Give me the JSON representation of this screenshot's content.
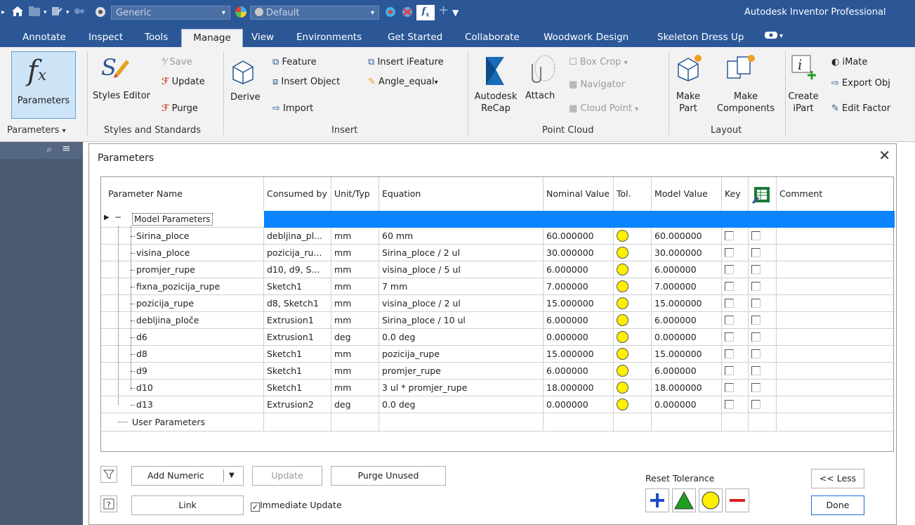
{
  "qat": {
    "style_combo": "Generic",
    "appearance_combo": "Default",
    "app_title": "Autodesk Inventor Professional"
  },
  "menu": {
    "tabs": [
      "Annotate",
      "Inspect",
      "Tools",
      "Manage",
      "View",
      "Environments",
      "Get Started",
      "Collaborate",
      "Woodwork Design",
      "Skeleton Dress Up"
    ],
    "active": "Manage"
  },
  "ribbon": {
    "parameters_label": "Parameters",
    "styles_editor": "Styles Editor",
    "save": "Save",
    "update": "Update",
    "purge": "Purge",
    "derive": "Derive",
    "feature": "Feature",
    "insert_object": "Insert Object",
    "import": "Import",
    "insert_ifeature": "Insert iFeature",
    "angle_equal": "Angle_equal",
    "autodesk_recap_1": "Autodesk",
    "autodesk_recap_2": "ReCap",
    "attach": "Attach",
    "box_crop": "Box Crop",
    "navigator": "Navigator",
    "cloud_point": "Cloud Point",
    "make_part_1": "Make",
    "make_part_2": "Part",
    "make_components_1": "Make",
    "make_components_2": "Components",
    "create_ipart_1": "Create",
    "create_ipart_2": "iPart",
    "imate": "iMate",
    "export_obj": "Export Obj",
    "edit_factor": "Edit Factor",
    "groups": {
      "parameters": "Parameters",
      "styles": "Styles and Standards",
      "insert": "Insert",
      "point_cloud": "Point Cloud",
      "layout": "Layout"
    }
  },
  "dialog": {
    "title": "Parameters",
    "columns": {
      "name": "Parameter Name",
      "consumed": "Consumed by",
      "unit": "Unit/Typ",
      "equation": "Equation",
      "nominal": "Nominal Value",
      "tol": "Tol.",
      "model": "Model Value",
      "key": "Key",
      "comment": "Comment"
    },
    "model_group": "Model Parameters",
    "user_group": "User Parameters",
    "rows": [
      {
        "name": "Sirina_ploce",
        "consumed": "debljina_pl...",
        "unit": "mm",
        "equation": "60 mm",
        "nominal": "60.000000",
        "model": "60.000000"
      },
      {
        "name": "visina_ploce",
        "consumed": "pozicija_ru...",
        "unit": "mm",
        "equation": "Sirina_ploce / 2 ul",
        "nominal": "30.000000",
        "model": "30.000000"
      },
      {
        "name": "promjer_rupe",
        "consumed": "d10, d9, S...",
        "unit": "mm",
        "equation": "visina_ploce / 5 ul",
        "nominal": "6.000000",
        "model": "6.000000"
      },
      {
        "name": "fixna_pozicija_rupe",
        "consumed": "Sketch1",
        "unit": "mm",
        "equation": "7 mm",
        "nominal": "7.000000",
        "model": "7.000000"
      },
      {
        "name": "pozicija_rupe",
        "consumed": "d8, Sketch1",
        "unit": "mm",
        "equation": "visina_ploce / 2 ul",
        "nominal": "15.000000",
        "model": "15.000000"
      },
      {
        "name": "debljina_ploče",
        "consumed": "Extrusion1",
        "unit": "mm",
        "equation": "Sirina_ploce / 10 ul",
        "nominal": "6.000000",
        "model": "6.000000"
      },
      {
        "name": "d6",
        "consumed": "Extrusion1",
        "unit": "deg",
        "equation": "0.0 deg",
        "nominal": "0.000000",
        "model": "0.000000"
      },
      {
        "name": "d8",
        "consumed": "Sketch1",
        "unit": "mm",
        "equation": "pozicija_rupe",
        "nominal": "15.000000",
        "model": "15.000000"
      },
      {
        "name": "d9",
        "consumed": "Sketch1",
        "unit": "mm",
        "equation": "promjer_rupe",
        "nominal": "6.000000",
        "model": "6.000000"
      },
      {
        "name": "d10",
        "consumed": "Sketch1",
        "unit": "mm",
        "equation": "3 ul * promjer_rupe",
        "nominal": "18.000000",
        "model": "18.000000"
      },
      {
        "name": "d13",
        "consumed": "Extrusion2",
        "unit": "deg",
        "equation": "0.0 deg",
        "nominal": "0.000000",
        "model": "0.000000"
      }
    ],
    "buttons": {
      "add_numeric": "Add Numeric",
      "update": "Update",
      "purge_unused": "Purge Unused",
      "link": "Link",
      "immediate_update": "Immediate Update",
      "reset_tolerance": "Reset Tolerance",
      "less": "<< Less",
      "done": "Done"
    }
  },
  "colors": {
    "title_bar": "#2b5797",
    "selection": "#0a84ff",
    "tolerance": "#ffef00"
  }
}
